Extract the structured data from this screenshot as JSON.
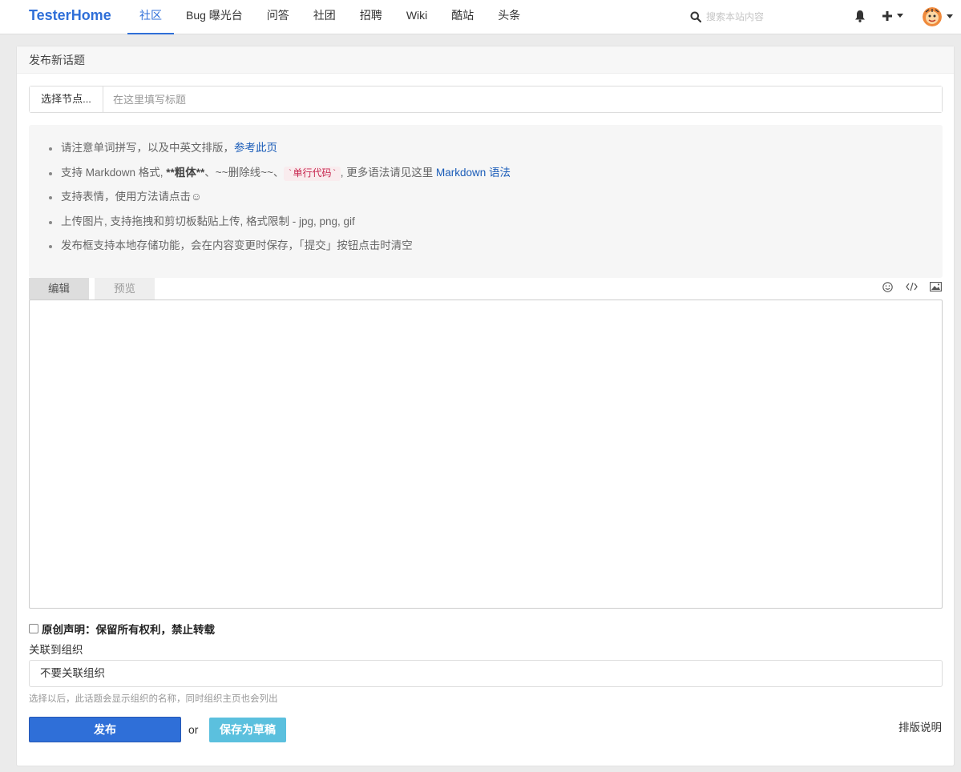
{
  "navbar": {
    "brand": "TesterHome",
    "items": [
      "社区",
      "Bug 曝光台",
      "问答",
      "社团",
      "招聘",
      "Wiki",
      "酷站",
      "头条"
    ],
    "active_index": 0,
    "search_placeholder": "搜索本站内容",
    "icons": [
      "search-icon",
      "bell-icon",
      "plus-icon",
      "caret-down-icon",
      "avatar"
    ]
  },
  "panel": {
    "heading": "发布新话题",
    "node_button": "选择节点...",
    "title_placeholder": "在这里填写标题",
    "tips": [
      {
        "text": "请注意单词拼写，以及中英文排版，",
        "link": "参考此页"
      },
      {
        "prefix": "支持 Markdown 格式, ",
        "bold": "**粗体**",
        "middle": "、~~删除线~~、",
        "code": "`单行代码`",
        "suffix": ", 更多语法请见这里 ",
        "link": "Markdown 语法"
      },
      {
        "text": "支持表情，使用方法请点击☺"
      },
      {
        "text": "上传图片, 支持拖拽和剪切板黏贴上传, 格式限制 - jpg, png, gif"
      },
      {
        "text": "发布框支持本地存储功能，会在内容变更时保存，「提交」按钮点击时清空"
      }
    ],
    "tabs": {
      "edit": "编辑",
      "preview": "预览"
    },
    "toolbar_icons": [
      "smile-icon",
      "code-icon",
      "image-icon"
    ],
    "editor_value": "",
    "original_label": "原创声明：保留所有权利，禁止转载",
    "original_checked": false,
    "org_label": "关联到组织",
    "org_selected": "不要关联组织",
    "org_help": "选择以后，此话题会显示组织的名称，同时组织主页也会列出",
    "publish_label": "发布",
    "or_text": "or",
    "draft_label": "保存为草稿",
    "format_help": "排版说明"
  },
  "colors": {
    "accent": "#2f6fd8",
    "draft": "#5bc0de",
    "background": "#ebebeb"
  }
}
